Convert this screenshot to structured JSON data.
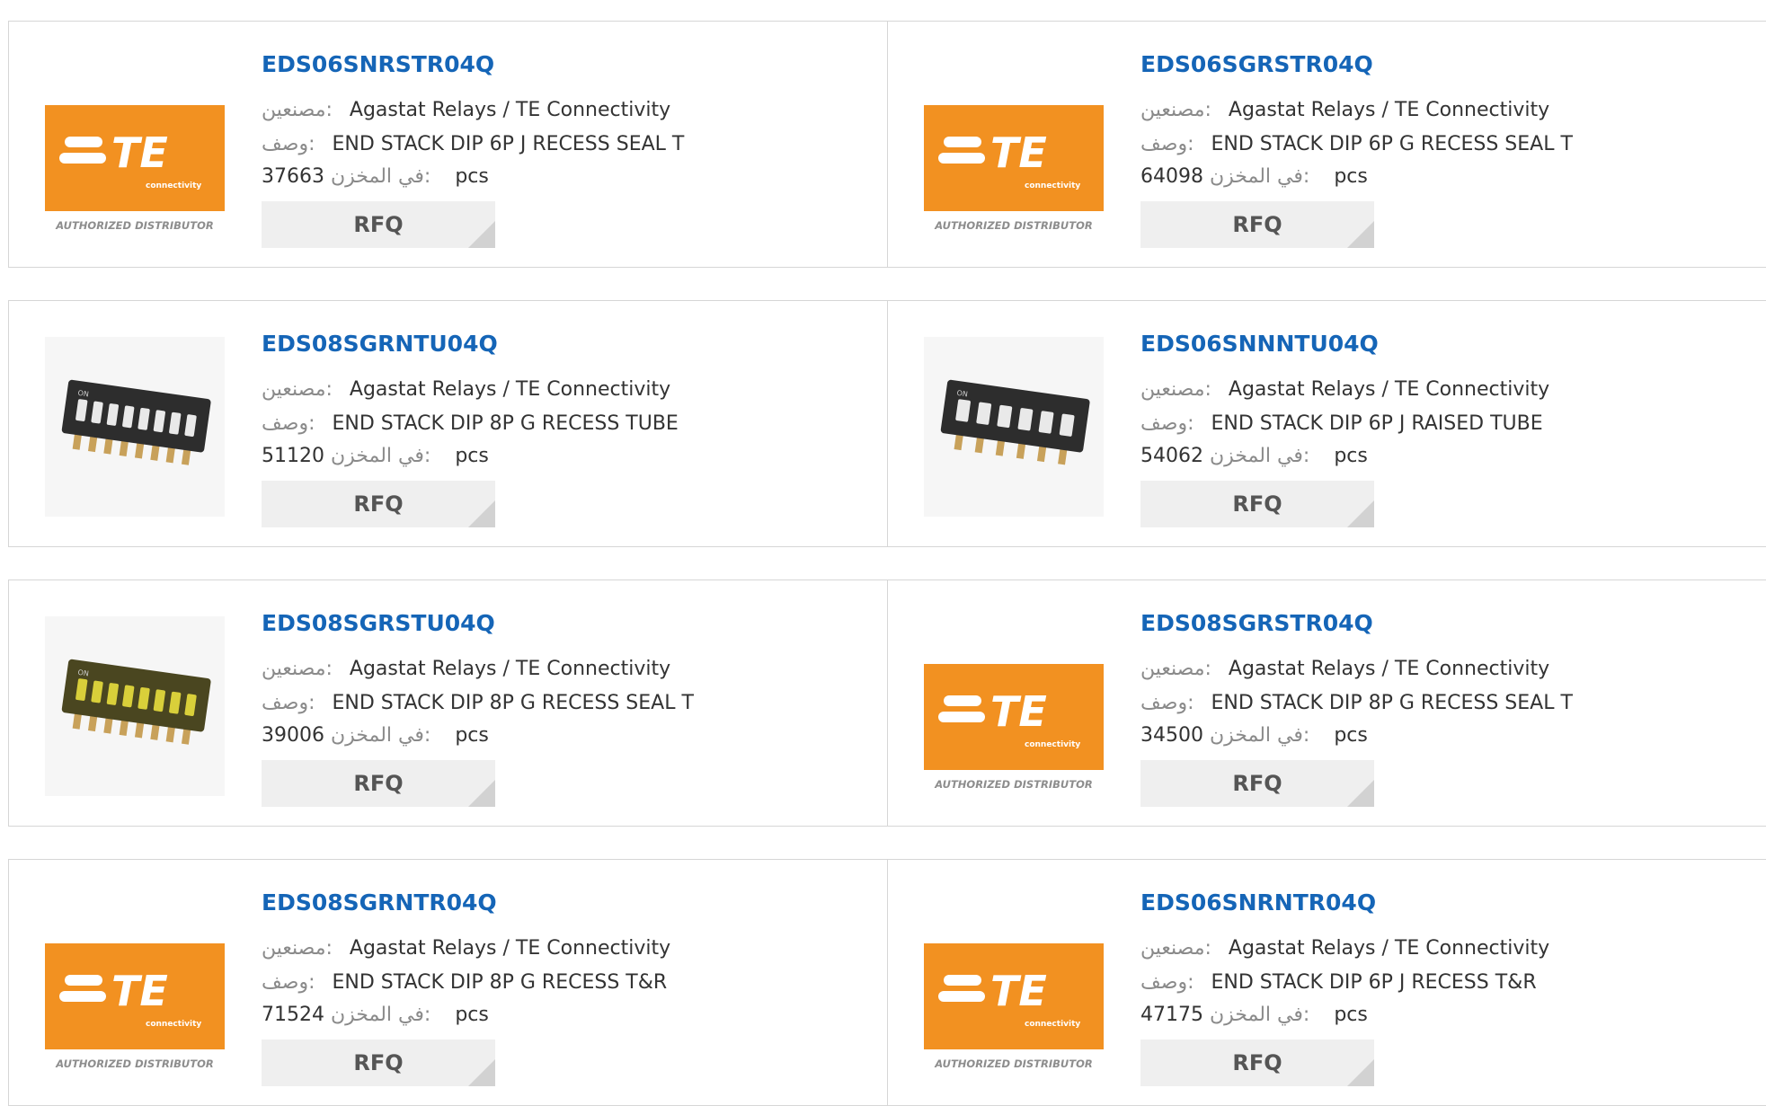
{
  "labels": {
    "manufacturer": "مصنعين:",
    "description": "وصف:",
    "in_stock": "في المخزن:",
    "unit": "pcs",
    "rfq": "RFQ"
  },
  "colors": {
    "part_number": "#1565b7",
    "te_orange": "#f29121",
    "rfq_bg": "#efefef",
    "border": "#d6d6d6"
  },
  "te_logo": {
    "wordmark": "TE",
    "tagline": "connectivity",
    "caption": "AUTHORIZED DISTRIBUTOR"
  },
  "dip_markings": {
    "on": "ON"
  },
  "products": [
    {
      "part_number": "EDS06SNRSTR04Q",
      "manufacturer": "Agastat Relays / TE Connectivity",
      "description": "END STACK DIP 6P J RECESS SEAL T",
      "stock": "37663",
      "image": "te-logo"
    },
    {
      "part_number": "EDS06SGRSTR04Q",
      "manufacturer": "Agastat Relays / TE Connectivity",
      "description": "END STACK DIP 6P G RECESS SEAL T",
      "stock": "64098",
      "image": "te-logo"
    },
    {
      "part_number": "EDS08SGRNTU04Q",
      "manufacturer": "Agastat Relays / TE Connectivity",
      "description": "END STACK DIP 8P G RECESS TUBE",
      "stock": "51120",
      "image": "dip-switch-8"
    },
    {
      "part_number": "EDS06SNNNTU04Q",
      "manufacturer": "Agastat Relays / TE Connectivity",
      "description": "END STACK DIP 6P J RAISED TUBE",
      "stock": "54062",
      "image": "dip-switch-6"
    },
    {
      "part_number": "EDS08SGRSTU04Q",
      "manufacturer": "Agastat Relays / TE Connectivity",
      "description": "END STACK DIP 8P G RECESS SEAL T",
      "stock": "39006",
      "image": "dip-switch-8-sealed"
    },
    {
      "part_number": "EDS08SGRSTR04Q",
      "manufacturer": "Agastat Relays / TE Connectivity",
      "description": "END STACK DIP 8P G RECESS SEAL T",
      "stock": "34500",
      "image": "te-logo"
    },
    {
      "part_number": "EDS08SGRNTR04Q",
      "manufacturer": "Agastat Relays / TE Connectivity",
      "description": "END STACK DIP 8P G RECESS T&R",
      "stock": "71524",
      "image": "te-logo"
    },
    {
      "part_number": "EDS06SNRNTR04Q",
      "manufacturer": "Agastat Relays / TE Connectivity",
      "description": "END STACK DIP 6P J RECESS T&R",
      "stock": "47175",
      "image": "te-logo"
    }
  ]
}
